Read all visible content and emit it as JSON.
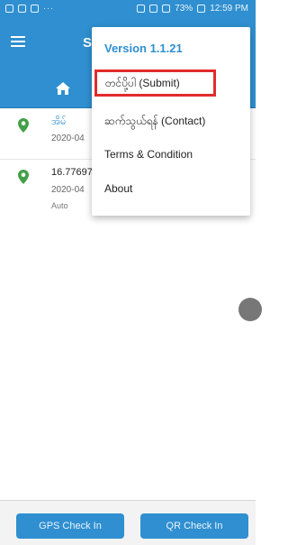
{
  "status_bar": {
    "time": "12:59 PM",
    "battery": "73%"
  },
  "app_bar": {
    "title": "S",
    "menu_icon": "menu-icon"
  },
  "tabs": {
    "home_icon": "home-icon"
  },
  "items": [
    {
      "title": "အိမ်",
      "date": "2020-04",
      "tag": ""
    },
    {
      "title": "16.77697",
      "date": "2020-04",
      "tag": "Auto"
    }
  ],
  "menu": {
    "version": "Version 1.1.21",
    "items": [
      {
        "label": "တင်ပို့ပါ (Submit)"
      },
      {
        "label": "ဆက်သွယ်ရန် (Contact)"
      },
      {
        "label": "Terms & Condition"
      },
      {
        "label": "About"
      }
    ]
  },
  "bottom": {
    "gps_label": "GPS Check In",
    "qr_label": "QR Check In"
  },
  "colors": {
    "primary": "#2f8fd0",
    "highlight_border": "#e22b2b",
    "pin": "#43a047"
  }
}
